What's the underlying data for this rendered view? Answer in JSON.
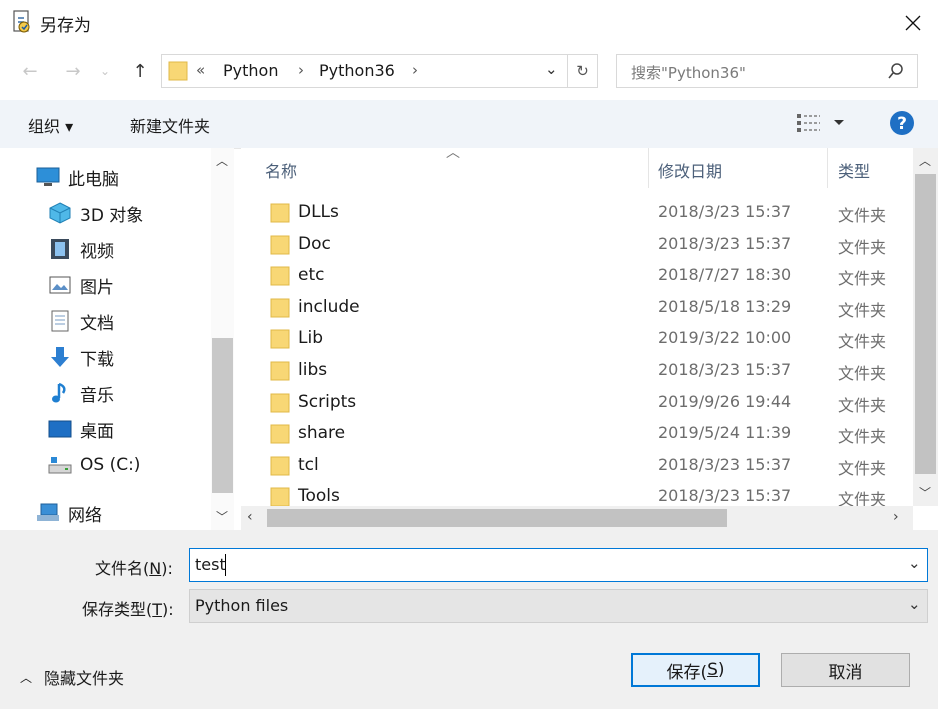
{
  "window": {
    "title": "另存为"
  },
  "addressbar": {
    "overflow": "«",
    "crumbs": [
      "Python",
      "Python36"
    ]
  },
  "search": {
    "placeholder": "搜索\"Python36\""
  },
  "toolbar": {
    "organize": "组织 ▾",
    "new_folder": "新建文件夹"
  },
  "sidebar": {
    "items": [
      {
        "label": "此电脑",
        "icon": "computer-icon"
      },
      {
        "label": "3D 对象",
        "icon": "cube-icon"
      },
      {
        "label": "视频",
        "icon": "video-icon"
      },
      {
        "label": "图片",
        "icon": "picture-icon"
      },
      {
        "label": "文档",
        "icon": "document-icon"
      },
      {
        "label": "下载",
        "icon": "download-icon"
      },
      {
        "label": "音乐",
        "icon": "music-icon"
      },
      {
        "label": "桌面",
        "icon": "desktop-icon"
      },
      {
        "label": "OS (C:)",
        "icon": "drive-icon"
      },
      {
        "label": "网络",
        "icon": "network-icon"
      }
    ]
  },
  "filelist": {
    "columns": {
      "name": "名称",
      "date": "修改日期",
      "type": "类型"
    },
    "rows": [
      {
        "name": "DLLs",
        "date": "2018/3/23 15:37",
        "type": "文件夹"
      },
      {
        "name": "Doc",
        "date": "2018/3/23 15:37",
        "type": "文件夹"
      },
      {
        "name": "etc",
        "date": "2018/7/27 18:30",
        "type": "文件夹"
      },
      {
        "name": "include",
        "date": "2018/5/18 13:29",
        "type": "文件夹"
      },
      {
        "name": "Lib",
        "date": "2019/3/22 10:00",
        "type": "文件夹"
      },
      {
        "name": "libs",
        "date": "2018/3/23 15:37",
        "type": "文件夹"
      },
      {
        "name": "Scripts",
        "date": "2019/9/26 19:44",
        "type": "文件夹"
      },
      {
        "name": "share",
        "date": "2019/5/24 11:39",
        "type": "文件夹"
      },
      {
        "name": "tcl",
        "date": "2018/3/23 15:37",
        "type": "文件夹"
      },
      {
        "name": "Tools",
        "date": "2018/3/23 15:37",
        "type": "文件夹"
      }
    ]
  },
  "form": {
    "filename_label_pre": "文件名(",
    "filename_label_key": "N",
    "filename_label_post": "):",
    "filename_value": "test",
    "filetype_label_pre": "保存类型(",
    "filetype_label_key": "T",
    "filetype_label_post": "):",
    "filetype_value": "Python files"
  },
  "footer": {
    "hide_folders": "隐藏文件夹",
    "save_pre": "保存(",
    "save_key": "S",
    "save_post": ")",
    "cancel": "取消"
  },
  "colors": {
    "accent": "#0078d7",
    "folder": "#f8d775",
    "help": "#1e6fc4"
  }
}
